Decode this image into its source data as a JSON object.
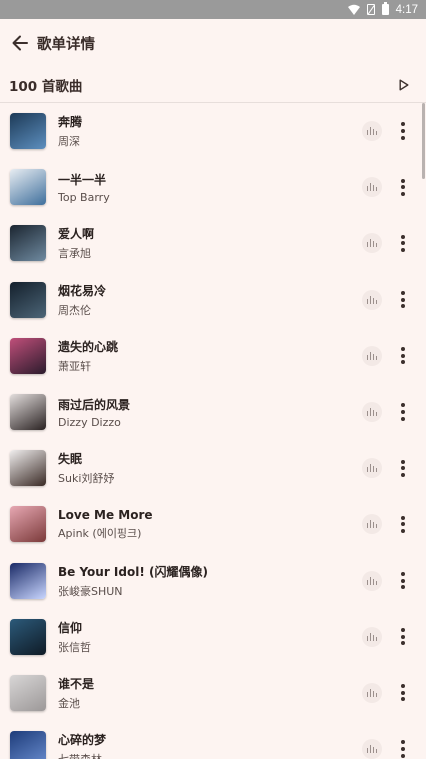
{
  "status_bar": {
    "time": "4:17",
    "icons": [
      "wifi-icon",
      "no-sim-icon",
      "battery-icon"
    ]
  },
  "header": {
    "title": "歌单详情",
    "back_icon": "arrow-left-icon"
  },
  "list_header": {
    "count_label": "100 首歌曲",
    "play_icon": "play-outline-icon"
  },
  "colors": {
    "background": "#fdf4f1",
    "status_bar": "#9a9a9a",
    "text_primary": "#2b2220",
    "icon": "#3c302d"
  },
  "songs": [
    {
      "title": "奔腾",
      "artist": "周深",
      "cover": [
        "#1d3a57",
        "#5d8fbf"
      ]
    },
    {
      "title": "一半一半",
      "artist": "Top Barry",
      "cover": [
        "#e8edf2",
        "#3f6f9c"
      ]
    },
    {
      "title": "爱人啊",
      "artist": "言承旭",
      "cover": [
        "#1b2530",
        "#6f8aa0"
      ]
    },
    {
      "title": "烟花易冷",
      "artist": "周杰伦",
      "cover": [
        "#14202c",
        "#4c6577"
      ]
    },
    {
      "title": "遗失的心跳",
      "artist": "萧亚轩",
      "cover": [
        "#c04f7a",
        "#2b1b2c"
      ]
    },
    {
      "title": "雨过后的风景",
      "artist": "Dizzy Dizzo",
      "cover": [
        "#e3dedd",
        "#2a2222"
      ]
    },
    {
      "title": "失眠",
      "artist": "Suki刘舒妤",
      "cover": [
        "#f0eeee",
        "#3a2a25"
      ]
    },
    {
      "title": "Love Me More",
      "artist": "Apink (에이핑크)",
      "cover": [
        "#e7a8b3",
        "#7b3a3a"
      ]
    },
    {
      "title": "Be Your Idol! (闪耀偶像)",
      "artist": "张峻豪SHUN",
      "cover": [
        "#1a2a66",
        "#c9d6ff"
      ]
    },
    {
      "title": "信仰",
      "artist": "张信哲",
      "cover": [
        "#2c5a7a",
        "#0f1b26"
      ]
    },
    {
      "title": "谁不是",
      "artist": "金池",
      "cover": [
        "#d8d6d6",
        "#9c9898"
      ]
    },
    {
      "title": "心碎的梦",
      "artist": "七带森林",
      "cover": [
        "#1e3c7a",
        "#6b8fd1"
      ]
    }
  ]
}
